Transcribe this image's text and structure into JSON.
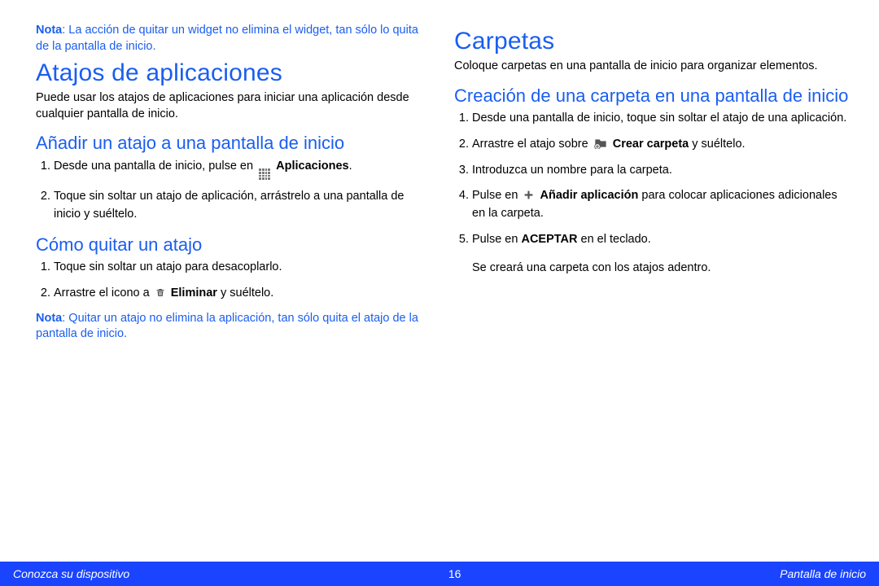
{
  "left": {
    "note1": {
      "label": "Nota",
      "text": ": La acción de quitar un widget no elimina el widget, tan sólo lo quita de la pantalla de inicio."
    },
    "h1": "Atajos de aplicaciones",
    "intro": "Puede usar los atajos de aplicaciones para iniciar una aplicación desde cualquier pantalla de inicio.",
    "h2a": "Añadir un atajo a una pantalla de inicio",
    "add": {
      "s1a": "Desde una pantalla de inicio, pulse en ",
      "s1_bold": "Aplicaciones",
      "s1b": ".",
      "s2": "Toque sin soltar un atajo de aplicación, arrástrelo a una pantalla de inicio y suéltelo."
    },
    "h2b": "Cómo quitar un atajo",
    "remove": {
      "s1": "Toque sin soltar un atajo para desacoplarlo.",
      "s2a": "Arrastre el icono a ",
      "s2_bold": "Eliminar",
      "s2b": " y suéltelo."
    },
    "note2": {
      "label": "Nota",
      "text": ": Quitar un atajo no elimina la aplicación, tan sólo quita el atajo de la pantalla de inicio."
    }
  },
  "right": {
    "h1": "Carpetas",
    "intro": "Coloque carpetas en una pantalla de inicio para organizar elementos.",
    "h2": "Creación de una carpeta en una pantalla de inicio",
    "steps": {
      "s1": "Desde una pantalla de inicio, toque sin soltar el atajo de una aplicación.",
      "s2a": "Arrastre el atajo sobre ",
      "s2_bold": "Crear carpeta",
      "s2b": " y suéltelo.",
      "s3": "Introduzca un nombre para la carpeta.",
      "s4a": "Pulse en ",
      "s4_bold": "Añadir aplicación",
      "s4b": " para colocar aplicaciones adicionales en la carpeta.",
      "s5a": "Pulse en ",
      "s5_bold": "ACEPTAR",
      "s5b": " en el teclado.",
      "tail": "Se creará una carpeta con los atajos adentro."
    }
  },
  "footer": {
    "left": "Conozca su dispositivo",
    "center": "16",
    "right": "Pantalla de inicio"
  }
}
